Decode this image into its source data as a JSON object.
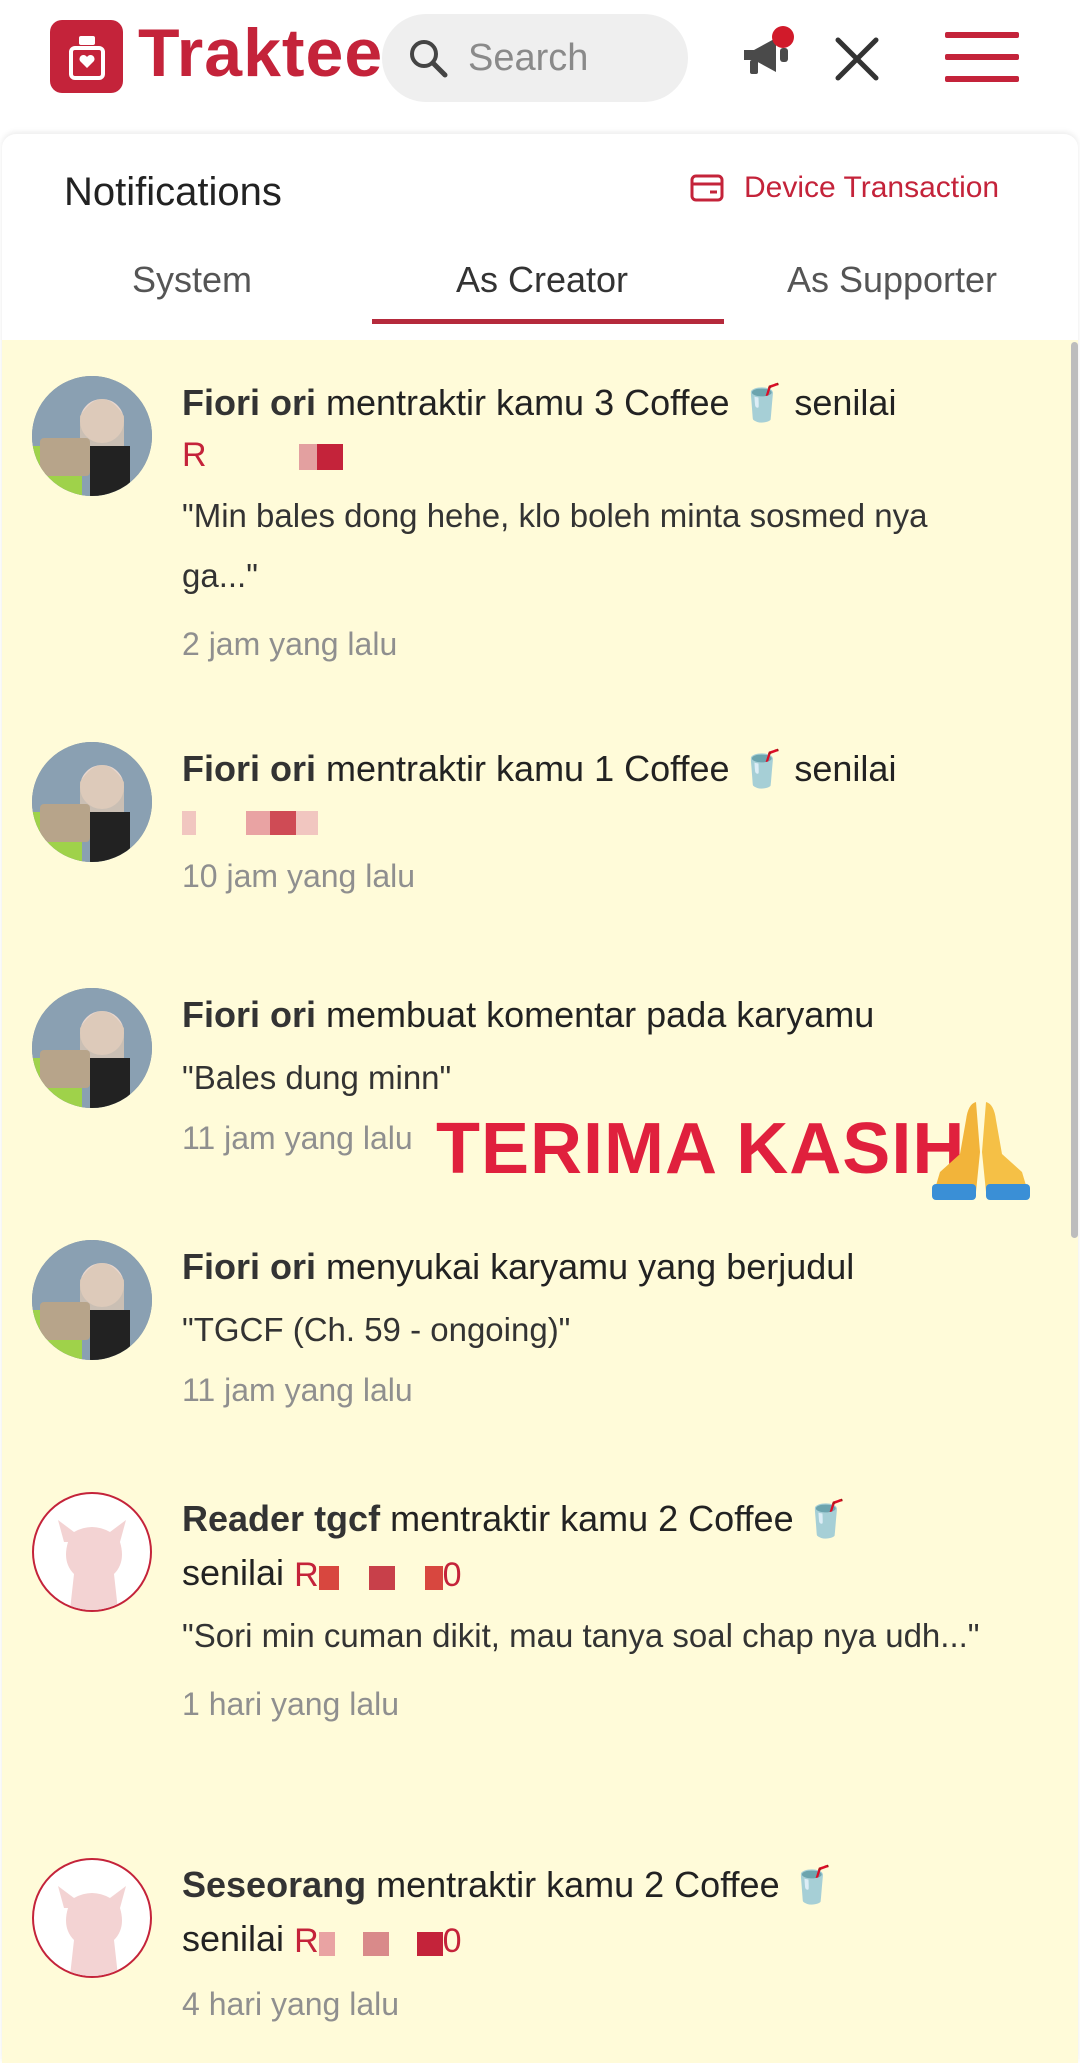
{
  "header": {
    "brand": "Trakteer",
    "search_placeholder": "Search",
    "icons": [
      "trakteer-logo-icon",
      "search-icon",
      "megaphone-icon",
      "close-icon",
      "menu-icon"
    ]
  },
  "panel": {
    "title": "Notifications",
    "device_transaction": "Device Transaction",
    "tabs": [
      {
        "label": "System",
        "active": false
      },
      {
        "label": "As Creator",
        "active": true
      },
      {
        "label": "As Supporter",
        "active": false
      }
    ]
  },
  "notifications": [
    {
      "user": "Fiori ori",
      "action": "mentraktir kamu 3 Coffee",
      "after": "senilai",
      "amount": "R",
      "message": "\"Min bales dong hehe, klo boleh minta sosmed nya ga...\"",
      "time": "2 jam yang lalu",
      "avatar": "photo"
    },
    {
      "user": "Fiori ori",
      "action": "mentraktir kamu 1 Coffee",
      "after": "senilai",
      "amount": "",
      "message": "",
      "time": "10 jam yang lalu",
      "avatar": "photo"
    },
    {
      "user": "Fiori ori",
      "action": "membuat komentar pada karyamu",
      "after": "",
      "amount": "",
      "message": "\"Bales dung minn\"",
      "time": "11 jam yang lalu",
      "avatar": "photo"
    },
    {
      "user": "Fiori ori",
      "action": "menyukai karyamu yang berjudul",
      "after": "",
      "amount": "",
      "message": "\"TGCF (Ch. 59 - ongoing)\"",
      "time": "11 jam yang lalu",
      "avatar": "photo"
    },
    {
      "user": "Reader tgcf",
      "action": "mentraktir kamu 2 Coffee",
      "after": "senilai",
      "amount": "R",
      "amount_end": "0",
      "message": "\"Sori min cuman dikit, mau tanya soal chap nya udh...\"",
      "time": "1 hari yang lalu",
      "avatar": "default"
    },
    {
      "user": "Seseorang",
      "action": "mentraktir kamu 2 Coffee",
      "after": "senilai",
      "amount": "R",
      "amount_end": "0",
      "message": "",
      "time": "4 hari yang lalu",
      "avatar": "default"
    }
  ],
  "overlay_text": "TERIMA KASIH",
  "colors": {
    "brand": "#c4233a",
    "list_bg": "#fffbd9",
    "overlay": "#e0203d"
  }
}
